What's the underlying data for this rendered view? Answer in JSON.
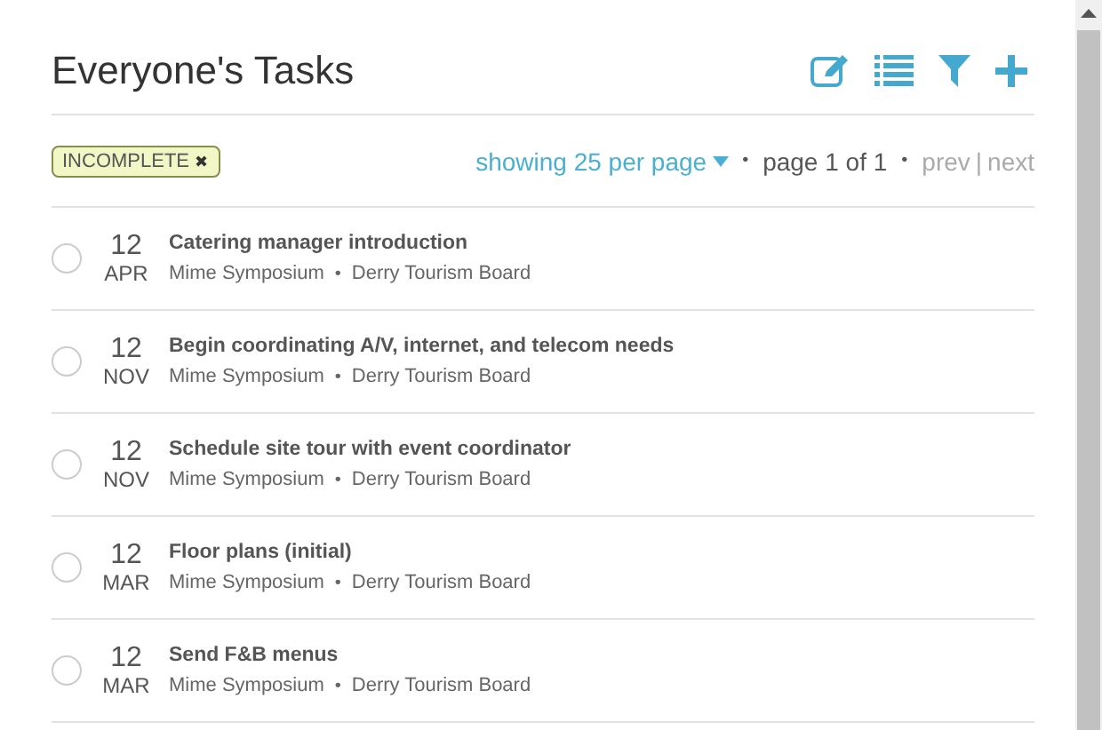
{
  "title": "Everyone's Tasks",
  "filter_tag": {
    "label": "INCOMPLETE",
    "remove": "✖"
  },
  "pagination": {
    "per_page": "showing 25 per page",
    "separator_1": "•",
    "page": "page 1 of 1",
    "separator_2": "•",
    "prev": "prev",
    "divider": "|",
    "next": "next"
  },
  "tasks": [
    {
      "checked": false,
      "day": "12",
      "month": "APR",
      "title": "Catering manager introduction",
      "event": "Mime Symposium",
      "separator": "•",
      "client": "Derry Tourism Board"
    },
    {
      "checked": false,
      "day": "12",
      "month": "NOV",
      "title": "Begin coordinating A/V, internet, and telecom needs",
      "event": "Mime Symposium",
      "separator": "•",
      "client": "Derry Tourism Board"
    },
    {
      "checked": false,
      "day": "12",
      "month": "NOV",
      "title": "Schedule site tour with event coordinator",
      "event": "Mime Symposium",
      "separator": "•",
      "client": "Derry Tourism Board"
    },
    {
      "checked": false,
      "day": "12",
      "month": "MAR",
      "title": "Floor plans (initial)",
      "event": "Mime Symposium",
      "separator": "•",
      "client": "Derry Tourism Board"
    },
    {
      "checked": false,
      "day": "12",
      "month": "MAR",
      "title": "Send F&B menus",
      "event": "Mime Symposium",
      "separator": "•",
      "client": "Derry Tourism Board"
    }
  ]
}
